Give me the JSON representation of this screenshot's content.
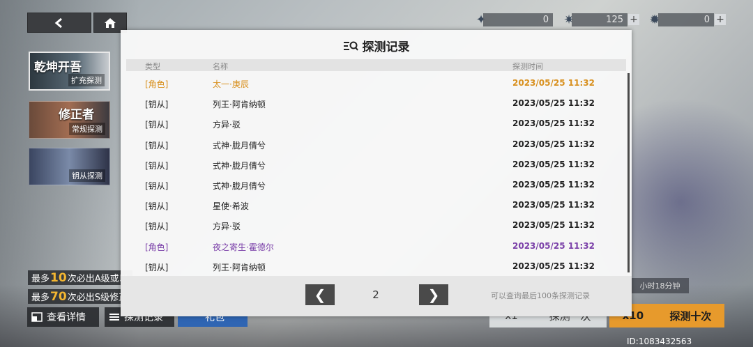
{
  "nav": {
    "back_icon": "chevron-left-icon",
    "home_icon": "home-icon"
  },
  "currencies": [
    {
      "icon": "ticket-icon",
      "value": "0"
    },
    {
      "icon": "star-crystal-icon",
      "value": "125"
    },
    {
      "icon": "star-gem-icon",
      "value": "0"
    }
  ],
  "banners": [
    {
      "title": "乾坤开吾",
      "sub": "扩充探测"
    },
    {
      "title": "修正者",
      "sub": "常规探测"
    },
    {
      "title": "",
      "sub": "钥从探测"
    }
  ],
  "info": {
    "line1_pre": "最多",
    "line1_num": "10",
    "line1_post": "次必出A级或以",
    "line2_pre": "最多",
    "line2_num": "70",
    "line2_post": "次必出S级修正"
  },
  "bottom": {
    "detail_label": "查看详情",
    "record_label": "探测记录",
    "gift_label": "礼包",
    "draw1_label": "探测一次",
    "draw1_count": "x1",
    "draw10_label": "探测十次",
    "draw10_count": "x10",
    "timer": "小时18分钟",
    "uid": "ID:1083432563"
  },
  "modal": {
    "title": "探测记录",
    "col_type": "类型",
    "col_name": "名称",
    "col_time": "探测时间",
    "rows": [
      {
        "type": "[角色]",
        "name": "太一·庚辰",
        "time": "2023/05/25 11:32",
        "rarity": "gold"
      },
      {
        "type": "[钥从]",
        "name": "列王·阿肯纳顿",
        "time": "2023/05/25 11:32",
        "rarity": "normal"
      },
      {
        "type": "[钥从]",
        "name": "方异·驳",
        "time": "2023/05/25 11:32",
        "rarity": "normal"
      },
      {
        "type": "[钥从]",
        "name": "式神·胧月倩兮",
        "time": "2023/05/25 11:32",
        "rarity": "normal"
      },
      {
        "type": "[钥从]",
        "name": "式神·胧月倩兮",
        "time": "2023/05/25 11:32",
        "rarity": "normal"
      },
      {
        "type": "[钥从]",
        "name": "式神·胧月倩兮",
        "time": "2023/05/25 11:32",
        "rarity": "normal"
      },
      {
        "type": "[钥从]",
        "name": "星使·希波",
        "time": "2023/05/25 11:32",
        "rarity": "normal"
      },
      {
        "type": "[钥从]",
        "name": "方异·驳",
        "time": "2023/05/25 11:32",
        "rarity": "normal"
      },
      {
        "type": "[角色]",
        "name": "夜之寄生·霍德尔",
        "time": "2023/05/25 11:32",
        "rarity": "purple"
      },
      {
        "type": "[钥从]",
        "name": "列王·阿肯纳顿",
        "time": "2023/05/25 11:32",
        "rarity": "normal"
      }
    ],
    "page": "2",
    "note": "可以查询最后100条探测记录"
  },
  "colors": {
    "gold": "#d8901e",
    "purple": "#7a3fa8",
    "normal": "#222222"
  }
}
